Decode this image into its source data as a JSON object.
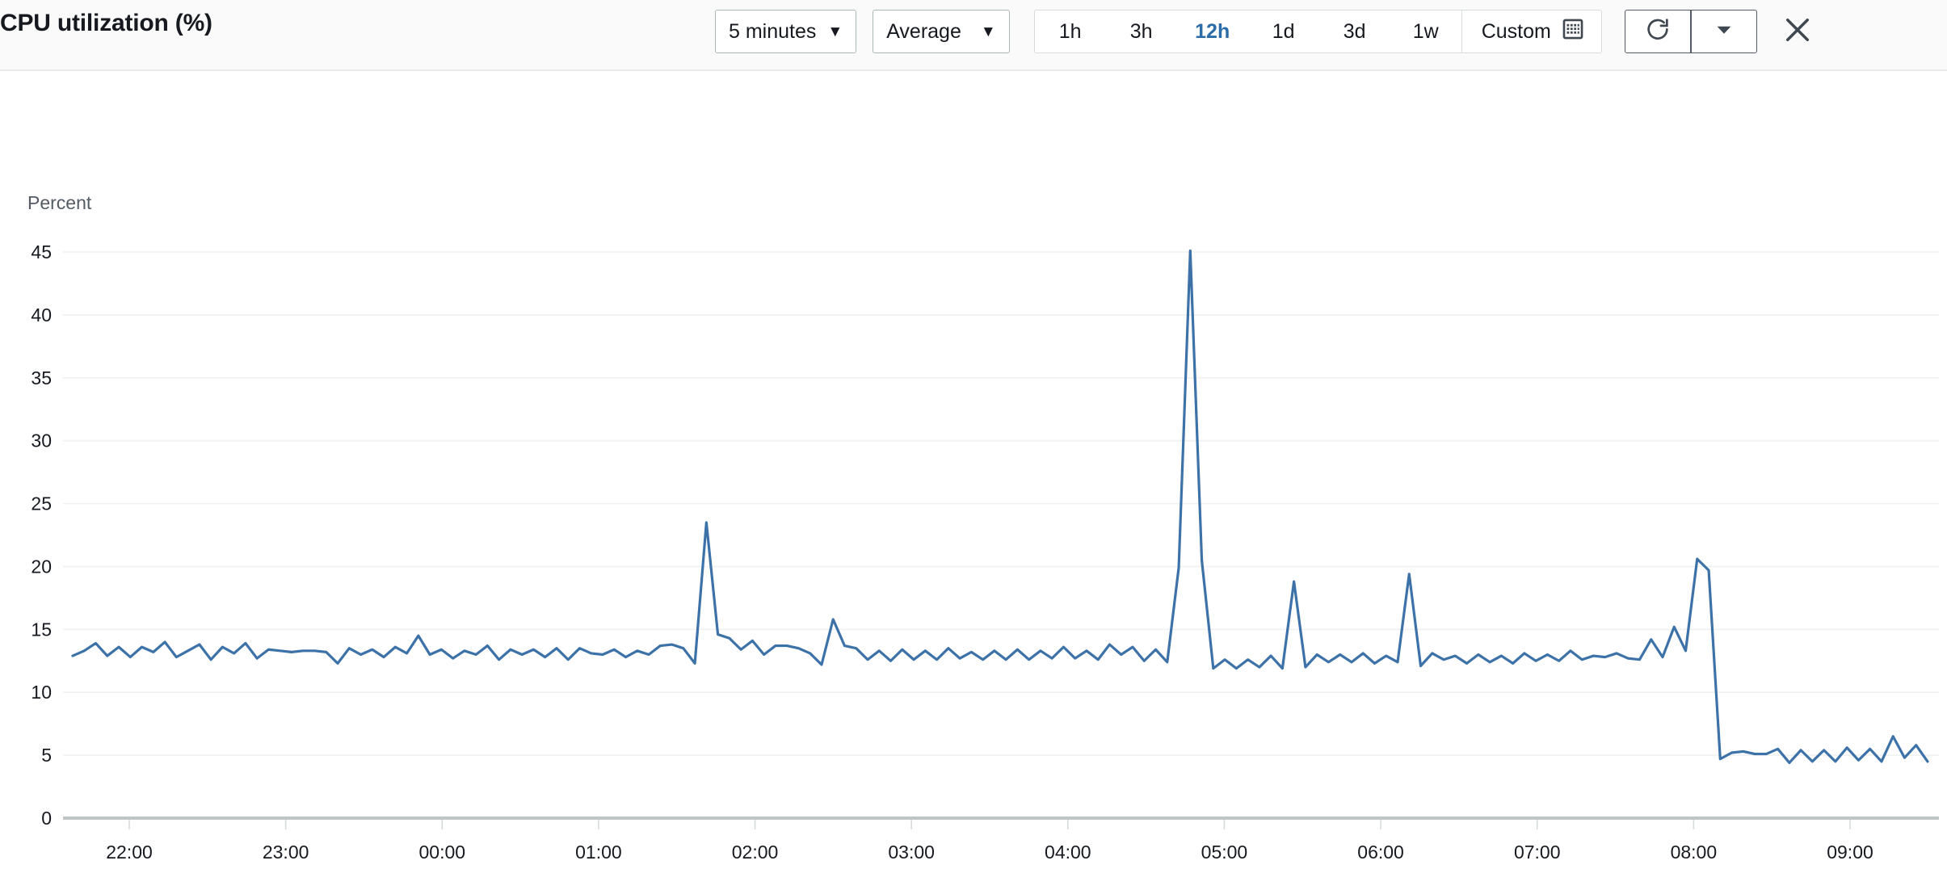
{
  "header": {
    "title": "CPU utilization (%)",
    "period_select": {
      "label": "5 minutes",
      "caret": "caret-down-icon"
    },
    "stat_select": {
      "label": "Average",
      "caret": "caret-down-icon"
    },
    "ranges": [
      {
        "label": "1h",
        "active": false
      },
      {
        "label": "3h",
        "active": false
      },
      {
        "label": "12h",
        "active": true
      },
      {
        "label": "1d",
        "active": false
      },
      {
        "label": "3d",
        "active": false
      },
      {
        "label": "1w",
        "active": false
      }
    ],
    "custom": {
      "label": "Custom",
      "icon": "calendar-icon"
    },
    "refresh": {
      "icon": "refresh-icon"
    },
    "refresh_menu": {
      "icon": "caret-down-icon"
    },
    "close": {
      "icon": "close-icon"
    },
    "accent_color": "#2c6ca8"
  },
  "chart_data": {
    "type": "line",
    "title": "CPU utilization (%)",
    "ylabel": "Percent",
    "xlabel": "",
    "ylim": [
      0,
      45
    ],
    "yticks": [
      0,
      5,
      10,
      15,
      20,
      25,
      30,
      35,
      40,
      45
    ],
    "xticks": [
      "22:00",
      "23:00",
      "00:00",
      "01:00",
      "02:00",
      "03:00",
      "04:00",
      "05:00",
      "06:00",
      "07:00",
      "08:00",
      "09:00"
    ],
    "grid": true,
    "legend": "none",
    "series": [
      {
        "name": "CPUUtilization",
        "color": "#3d72a8",
        "statistic": "Average",
        "period": "5 minutes",
        "values": [
          12.9,
          13.3,
          13.9,
          12.9,
          13.6,
          12.8,
          13.6,
          13.2,
          14.0,
          12.8,
          13.3,
          13.8,
          12.6,
          13.6,
          13.1,
          13.9,
          12.7,
          13.4,
          13.3,
          13.2,
          13.3,
          13.3,
          13.2,
          12.3,
          13.5,
          13.0,
          13.4,
          12.8,
          13.6,
          13.1,
          14.5,
          13.0,
          13.4,
          12.7,
          13.3,
          13.0,
          13.7,
          12.6,
          13.4,
          13.0,
          13.4,
          12.8,
          13.5,
          12.6,
          13.5,
          13.1,
          13.0,
          13.4,
          12.8,
          13.3,
          13.0,
          13.7,
          13.8,
          13.5,
          12.3,
          23.5,
          14.6,
          14.3,
          13.4,
          14.1,
          13.0,
          13.7,
          13.7,
          13.5,
          13.1,
          12.2,
          15.8,
          13.7,
          13.5,
          12.6,
          13.3,
          12.5,
          13.4,
          12.6,
          13.3,
          12.6,
          13.5,
          12.7,
          13.2,
          12.6,
          13.3,
          12.6,
          13.4,
          12.6,
          13.3,
          12.7,
          13.6,
          12.7,
          13.3,
          12.6,
          13.8,
          13.0,
          13.6,
          12.5,
          13.4,
          12.4,
          19.9,
          45.1,
          20.5,
          11.9,
          12.6,
          11.9,
          12.6,
          12.0,
          12.9,
          11.9,
          18.8,
          12.0,
          13.0,
          12.4,
          13.0,
          12.4,
          13.1,
          12.3,
          12.9,
          12.4,
          19.4,
          12.1,
          13.1,
          12.6,
          12.9,
          12.3,
          13.0,
          12.4,
          12.9,
          12.3,
          13.1,
          12.5,
          13.0,
          12.5,
          13.3,
          12.6,
          12.9,
          12.8,
          13.1,
          12.7,
          12.6,
          14.2,
          12.8,
          15.2,
          13.3,
          20.6,
          19.7,
          4.7,
          5.2,
          5.3,
          5.1,
          5.1,
          5.5,
          4.4,
          5.4,
          4.5,
          5.4,
          4.5,
          5.6,
          4.6,
          5.5,
          4.5,
          6.5,
          4.8,
          5.8,
          4.5
        ],
        "peaks": [
          {
            "time": "01:30",
            "value": 23.5
          },
          {
            "time": "04:25",
            "value": 45.1
          },
          {
            "time": "05:00",
            "value": 18.8
          },
          {
            "time": "06:00",
            "value": 19.4
          },
          {
            "time": "07:40",
            "value": 20.6
          }
        ],
        "min": 4.4,
        "max": 45.1
      }
    ]
  }
}
